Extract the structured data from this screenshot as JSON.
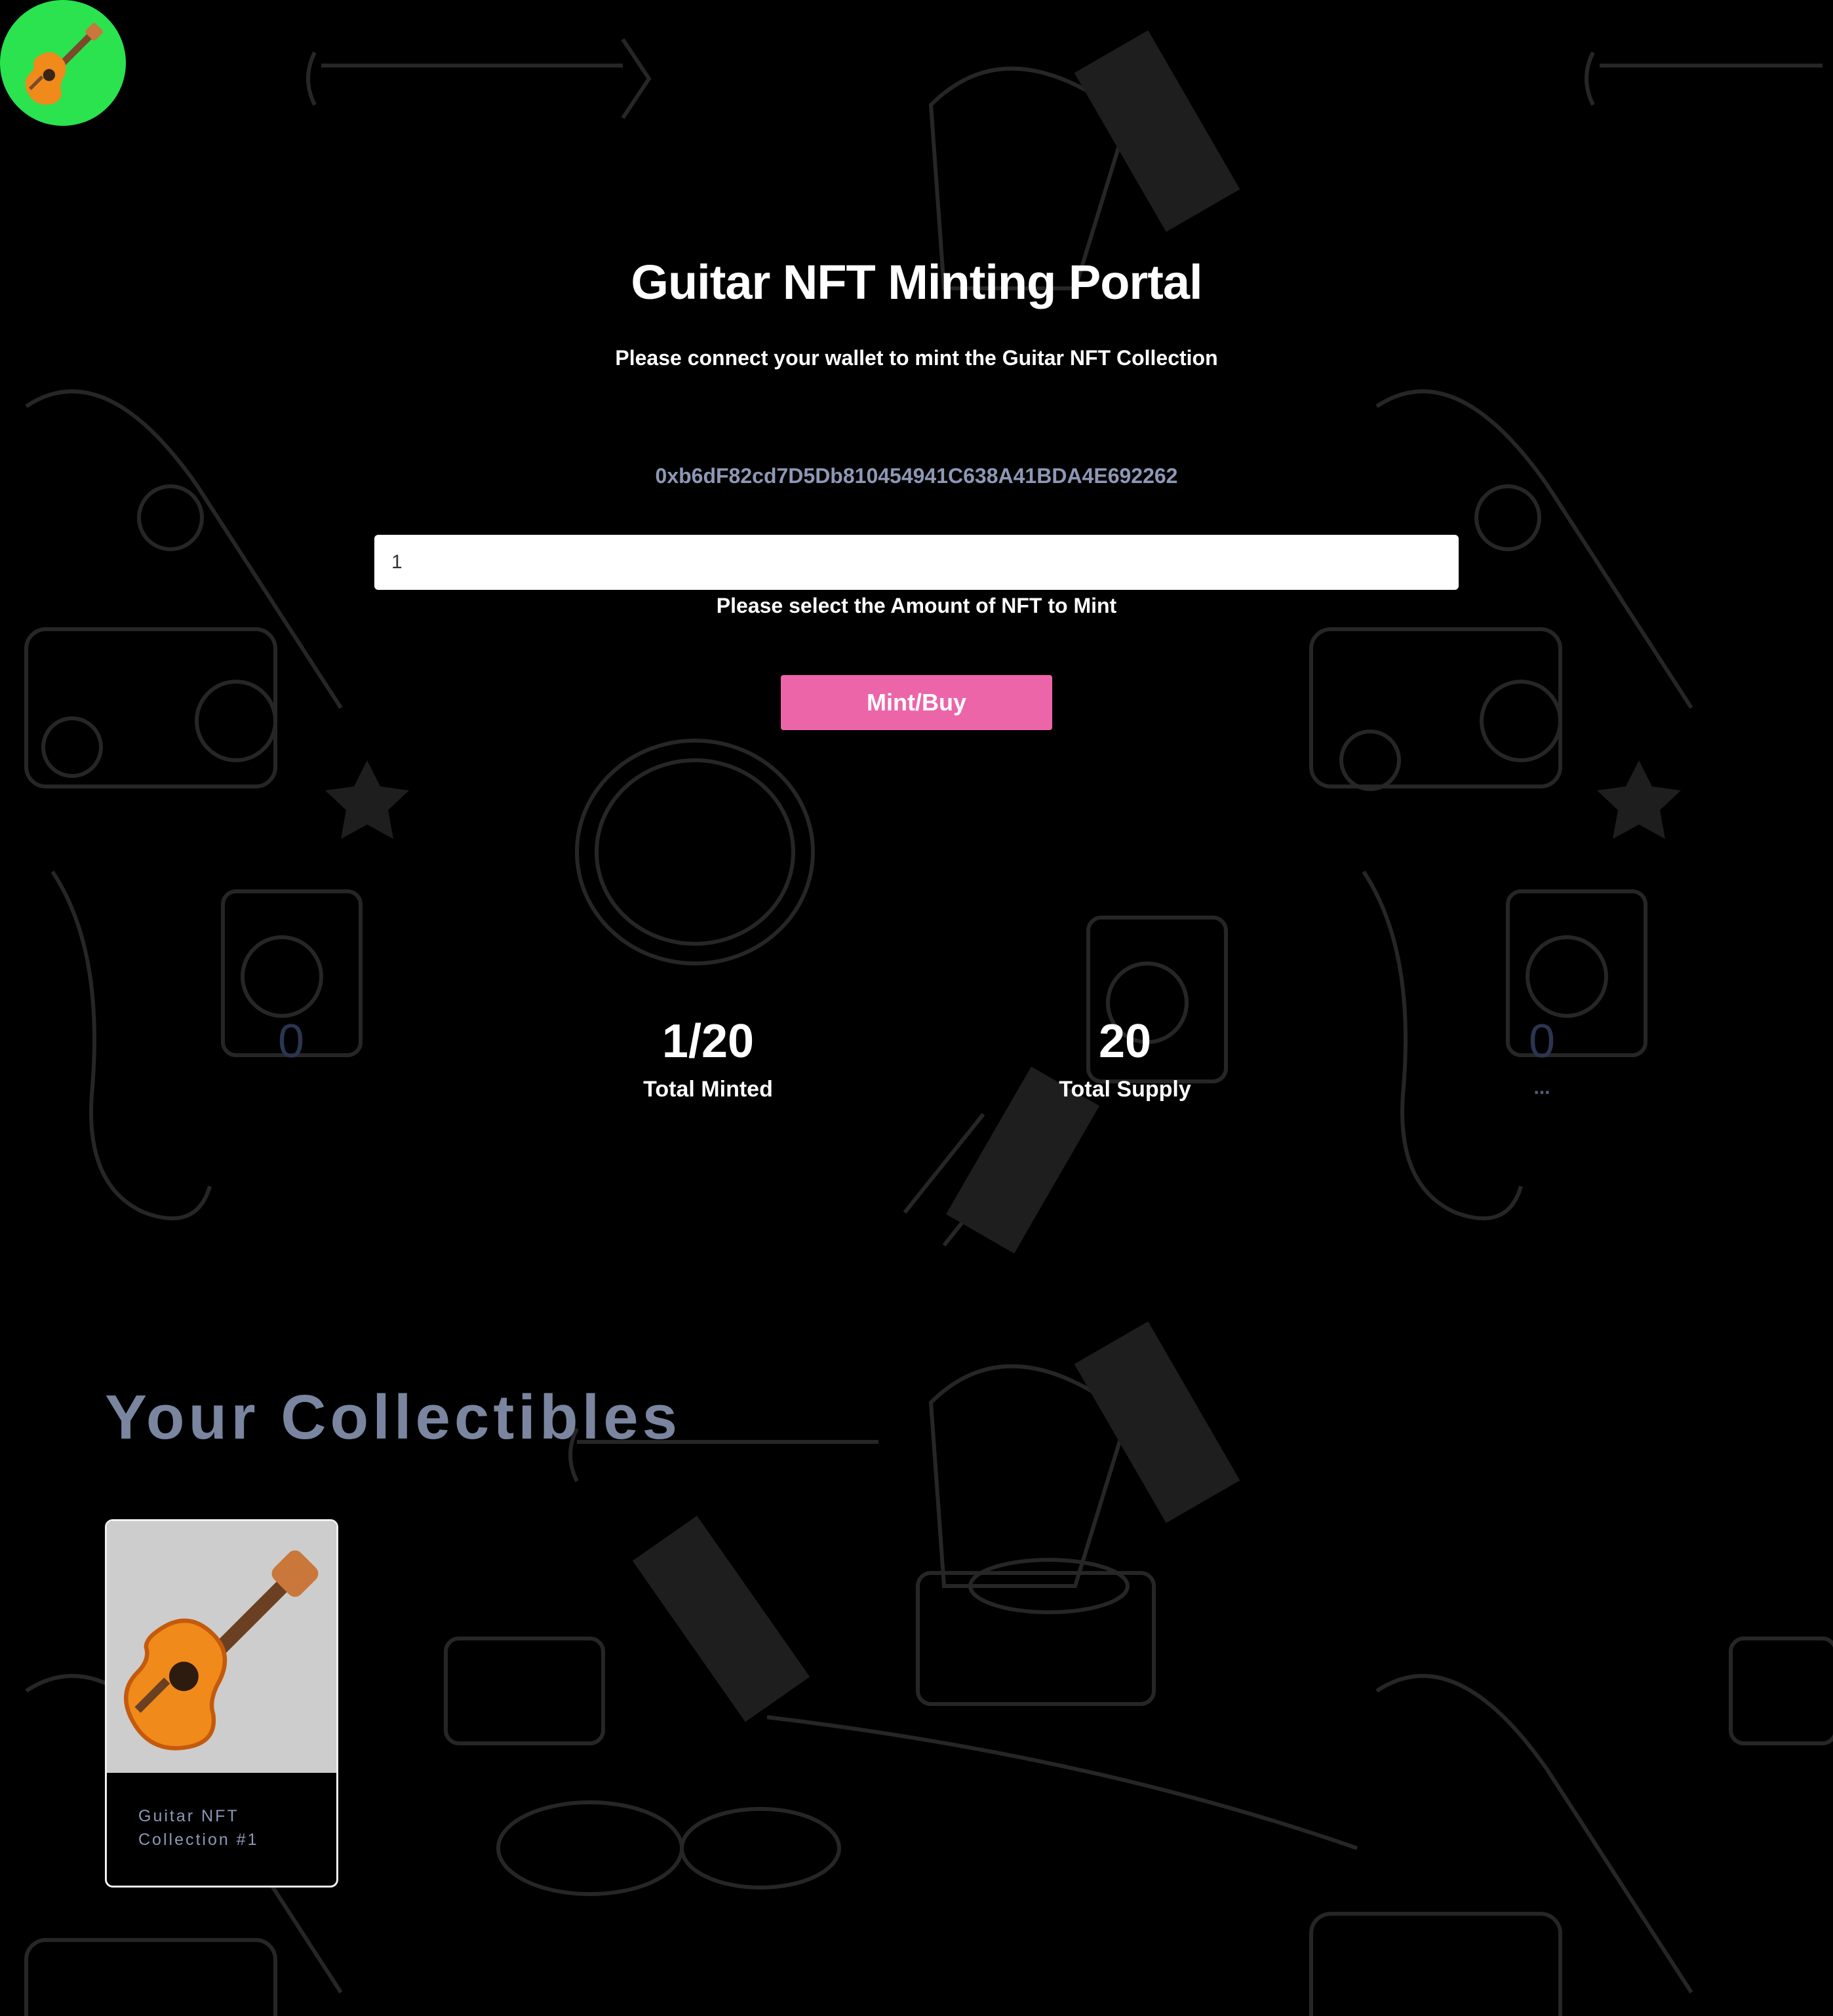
{
  "app": {
    "title": "Guitar NFT Minting Portal",
    "subtitle": "Please connect your wallet to mint the Guitar NFT Collection",
    "wallet_address": "0xb6dF82cd7D5Db810454941C638A41BDA4E692262"
  },
  "mint_form": {
    "amount_value": "1",
    "amount_label": "Please select the Amount of NFT to Mint",
    "mint_button_label": "Mint/Buy"
  },
  "stats": [
    {
      "value": "0",
      "label": ""
    },
    {
      "value": "1/20",
      "label": "Total Minted"
    },
    {
      "value": "20",
      "label": "Total Supply"
    },
    {
      "value": "0",
      "label": "..."
    }
  ],
  "collectibles": {
    "heading": "Your Collectibles",
    "items": [
      {
        "title": "Guitar NFT Collection #1",
        "icon": "guitar-icon"
      }
    ]
  },
  "colors": {
    "background": "#000000",
    "logo": "#2ae34f",
    "accent_button": "#ec65a9",
    "muted_text": "#8e98b5"
  }
}
